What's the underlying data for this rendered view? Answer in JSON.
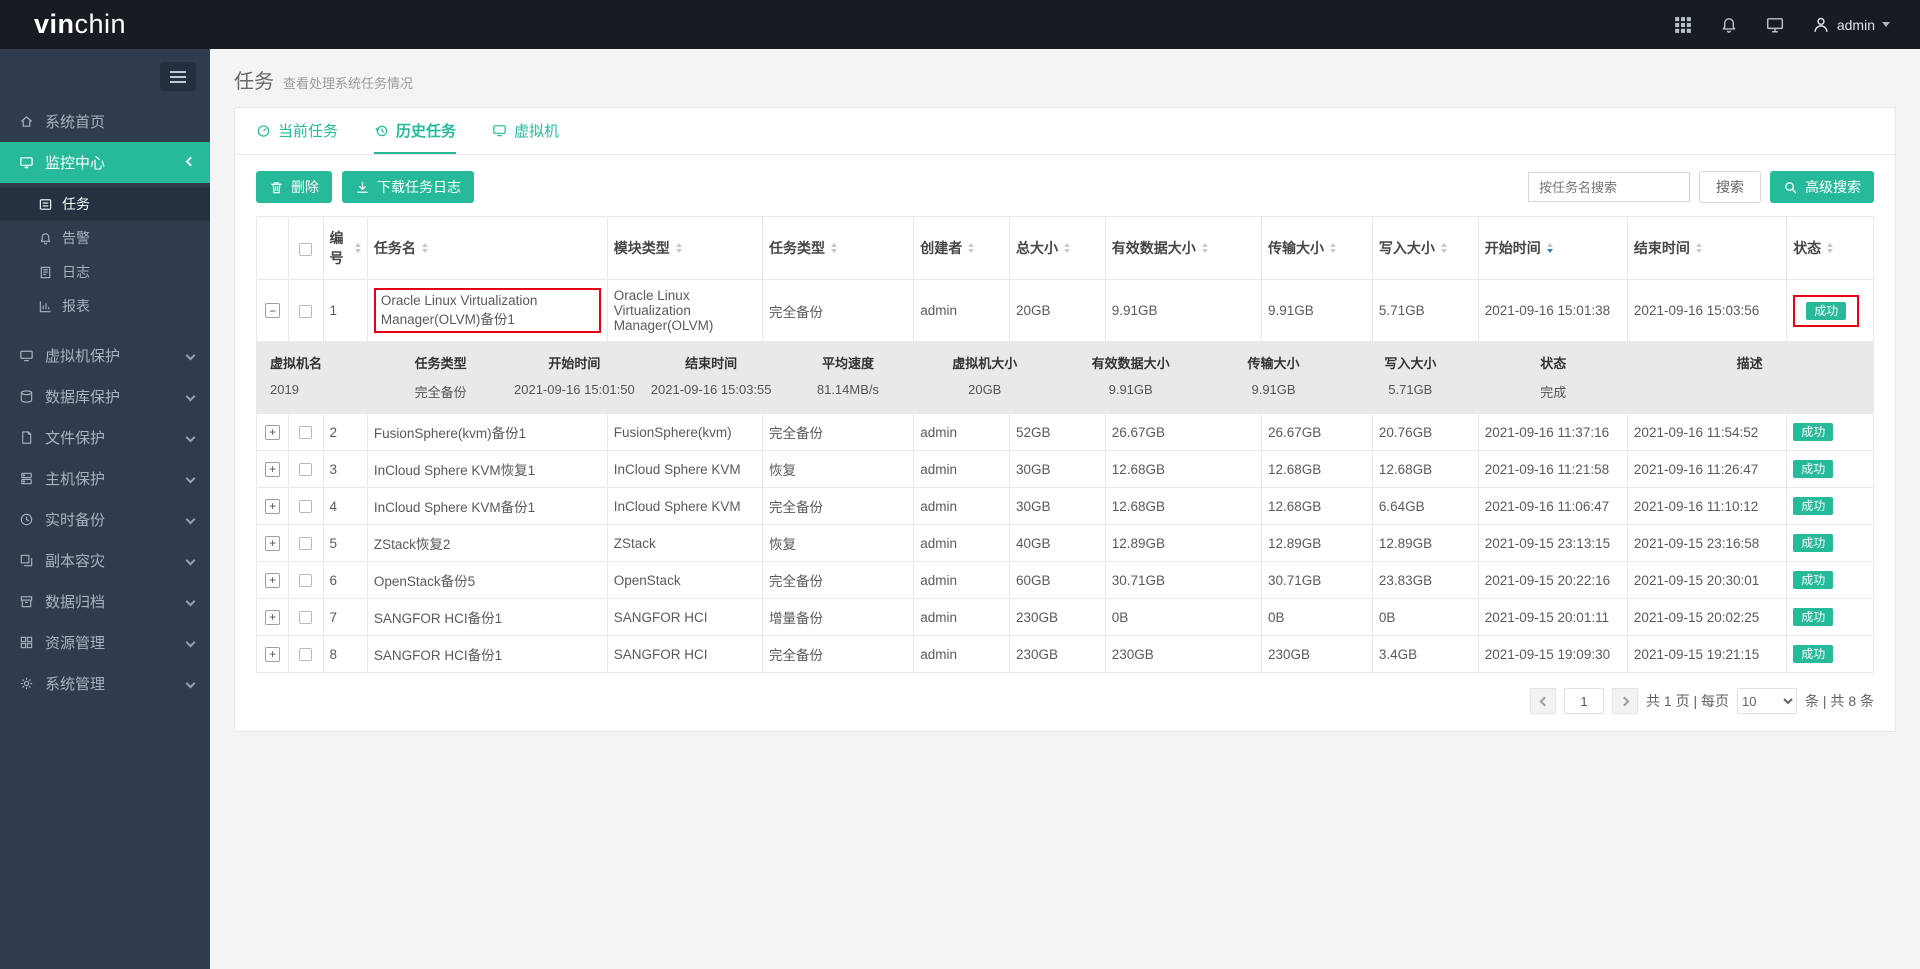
{
  "brand": {
    "vin": "vin",
    "chin": "chin"
  },
  "topbar": {
    "user_name": "admin"
  },
  "icons": {
    "expand_open": "−",
    "expand_closed": "+"
  },
  "sidebar": {
    "items": [
      {
        "label": "系统首页"
      },
      {
        "label": "监控中心",
        "active": true,
        "children": [
          {
            "label": "任务",
            "active": true
          },
          {
            "label": "告警"
          },
          {
            "label": "日志"
          },
          {
            "label": "报表"
          }
        ]
      },
      {
        "label": "虚拟机保护"
      },
      {
        "label": "数据库保护"
      },
      {
        "label": "文件保护"
      },
      {
        "label": "主机保护"
      },
      {
        "label": "实时备份"
      },
      {
        "label": "副本容灾"
      },
      {
        "label": "数据归档"
      },
      {
        "label": "资源管理"
      },
      {
        "label": "系统管理"
      }
    ]
  },
  "page": {
    "title": "任务",
    "subtitle": "查看处理系统任务情况"
  },
  "tabs": {
    "current": "当前任务",
    "history": "历史任务",
    "vm": "虚拟机"
  },
  "toolbar": {
    "delete_label": "删除",
    "download_label": "下载任务日志",
    "search_placeholder": "按任务名搜索",
    "search_label": "搜索",
    "advanced_search_label": "高级搜索"
  },
  "table": {
    "headers": {
      "num": "编号",
      "name": "任务名",
      "module": "模块类型",
      "type": "任务类型",
      "creator": "创建者",
      "total": "总大小",
      "valid": "有效数据大小",
      "transfer": "传输大小",
      "written": "写入大小",
      "start": "开始时间",
      "end": "结束时间",
      "status": "状态"
    },
    "rows": [
      {
        "num": "1",
        "name": "Oracle Linux Virtualization Manager(OLVM)备份1",
        "module": "Oracle Linux Virtualization Manager(OLVM)",
        "type": "完全备份",
        "creator": "admin",
        "total": "20GB",
        "valid": "9.91GB",
        "transfer": "9.91GB",
        "written": "5.71GB",
        "start": "2021-09-16 15:01:38",
        "end": "2021-09-16 15:03:56",
        "status": "成功"
      },
      {
        "num": "2",
        "name": "FusionSphere(kvm)备份1",
        "module": "FusionSphere(kvm)",
        "type": "完全备份",
        "creator": "admin",
        "total": "52GB",
        "valid": "26.67GB",
        "transfer": "26.67GB",
        "written": "20.76GB",
        "start": "2021-09-16 11:37:16",
        "end": "2021-09-16 11:54:52",
        "status": "成功"
      },
      {
        "num": "3",
        "name": "InCloud Sphere KVM恢复1",
        "module": "InCloud Sphere KVM",
        "type": "恢复",
        "creator": "admin",
        "total": "30GB",
        "valid": "12.68GB",
        "transfer": "12.68GB",
        "written": "12.68GB",
        "start": "2021-09-16 11:21:58",
        "end": "2021-09-16 11:26:47",
        "status": "成功"
      },
      {
        "num": "4",
        "name": "InCloud Sphere KVM备份1",
        "module": "InCloud Sphere KVM",
        "type": "完全备份",
        "creator": "admin",
        "total": "30GB",
        "valid": "12.68GB",
        "transfer": "12.68GB",
        "written": "6.64GB",
        "start": "2021-09-16 11:06:47",
        "end": "2021-09-16 11:10:12",
        "status": "成功"
      },
      {
        "num": "5",
        "name": "ZStack恢复2",
        "module": "ZStack",
        "type": "恢复",
        "creator": "admin",
        "total": "40GB",
        "valid": "12.89GB",
        "transfer": "12.89GB",
        "written": "12.89GB",
        "start": "2021-09-15 23:13:15",
        "end": "2021-09-15 23:16:58",
        "status": "成功"
      },
      {
        "num": "6",
        "name": "OpenStack备份5",
        "module": "OpenStack",
        "type": "完全备份",
        "creator": "admin",
        "total": "60GB",
        "valid": "30.71GB",
        "transfer": "30.71GB",
        "written": "23.83GB",
        "start": "2021-09-15 20:22:16",
        "end": "2021-09-15 20:30:01",
        "status": "成功"
      },
      {
        "num": "7",
        "name": "SANGFOR HCI备份1",
        "module": "SANGFOR HCI",
        "type": "增量备份",
        "creator": "admin",
        "total": "230GB",
        "valid": "0B",
        "transfer": "0B",
        "written": "0B",
        "start": "2021-09-15 20:01:11",
        "end": "2021-09-15 20:02:25",
        "status": "成功"
      },
      {
        "num": "8",
        "name": "SANGFOR HCI备份1",
        "module": "SANGFOR HCI",
        "type": "完全备份",
        "creator": "admin",
        "total": "230GB",
        "valid": "230GB",
        "transfer": "230GB",
        "written": "3.4GB",
        "start": "2021-09-15 19:09:30",
        "end": "2021-09-15 19:21:15",
        "status": "成功"
      }
    ],
    "detail": {
      "labels": [
        "虚拟机名",
        "任务类型",
        "开始时间",
        "结束时间",
        "平均速度",
        "虚拟机大小",
        "有效数据大小",
        "传输大小",
        "写入大小",
        "状态",
        "描述"
      ],
      "values": [
        "2019",
        "完全备份",
        "2021-09-16 15:01:50",
        "2021-09-16 15:03:55",
        "81.14MB/s",
        "20GB",
        "9.91GB",
        "9.91GB",
        "5.71GB",
        "完成",
        ""
      ]
    }
  },
  "pagination": {
    "page": "1",
    "pages_text": "共 1 页 | 每页",
    "per_page": "10",
    "count_text": "条 | 共 8 条"
  },
  "colors": {
    "accent": "#26b99a",
    "topbar": "#171b22",
    "sidebar": "#2e3c4e",
    "annotation": "#e60012",
    "sort_active": "#1c84c6"
  }
}
